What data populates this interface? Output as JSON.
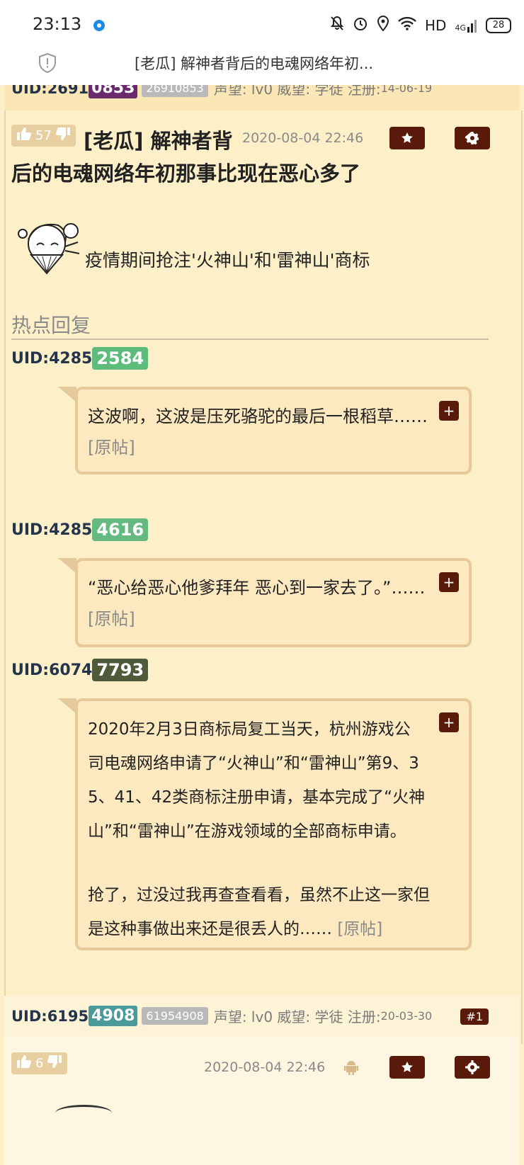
{
  "status_bar": {
    "time": "23:13",
    "network": "HD",
    "signal": "4G",
    "battery": "28"
  },
  "browser": {
    "page_title": "[老瓜] 解神者背后的电魂网络年初..."
  },
  "prev_post": {
    "uid_prefix": "UID:2691",
    "uid_badge": "0853",
    "uid_full": "26910853",
    "meta_prefix": "声望: lv0 威望: 学徒 注册: ",
    "meta_date": "14-06-19"
  },
  "main_post": {
    "likes": "57",
    "title_line1": "[老瓜] 解神者背",
    "title_line2": "后的电魂网络年初那事比现在恶心多了",
    "date": "2020-08-04 22:46",
    "signature": "疫情期间抢注'火神山'和'雷神山'商标",
    "hot_replies_heading": "热点回复",
    "replies": [
      {
        "uid_prefix": "UID:4285",
        "uid_badge": "2584",
        "badge_color": "#5dbb7c",
        "text": "这波啊，这波是压死骆驼的最后一根稻草……",
        "link": "[原帖]"
      },
      {
        "uid_prefix": "UID:4285",
        "uid_badge": "4616",
        "badge_color": "#63b97f",
        "text": "“恶心给恶心他爹拜年 恶心到一家去了。”……",
        "link": "[原帖]"
      },
      {
        "uid_prefix": "UID:6074",
        "uid_badge": "7793",
        "badge_color": "#4e5a3a",
        "text_p1_lines": [
          "2020年2月3日商标局复工当天，杭州游戏公",
          "司电魂网络申请了“火神山”和“雷神山”第9、3",
          "5、41、42类商标注册申请，基本完成了“火神",
          "山”和“雷神山”在游戏领域的全部商标申请。"
        ],
        "text_p2_lines": [
          "抢了，过没过我再查查看看，虽然不止这一家但",
          "是这种事做出来还是很丢人的……"
        ],
        "link": "[原帖]"
      }
    ]
  },
  "next_post": {
    "uid_prefix": "UID:6195",
    "uid_badge": "4908",
    "uid_full": "61954908",
    "meta_prefix": "声望: lv0 威望: 学徒 注册: ",
    "meta_date": "20-03-30",
    "floor": "#1",
    "likes": "6",
    "date": "2020-08-04 22:46"
  },
  "colors": {
    "page_bg": "#fdf0c8",
    "dark_button": "#5a1a0a",
    "purple_badge": "#6a2a6e",
    "teal_badge": "#4a9a9c"
  }
}
